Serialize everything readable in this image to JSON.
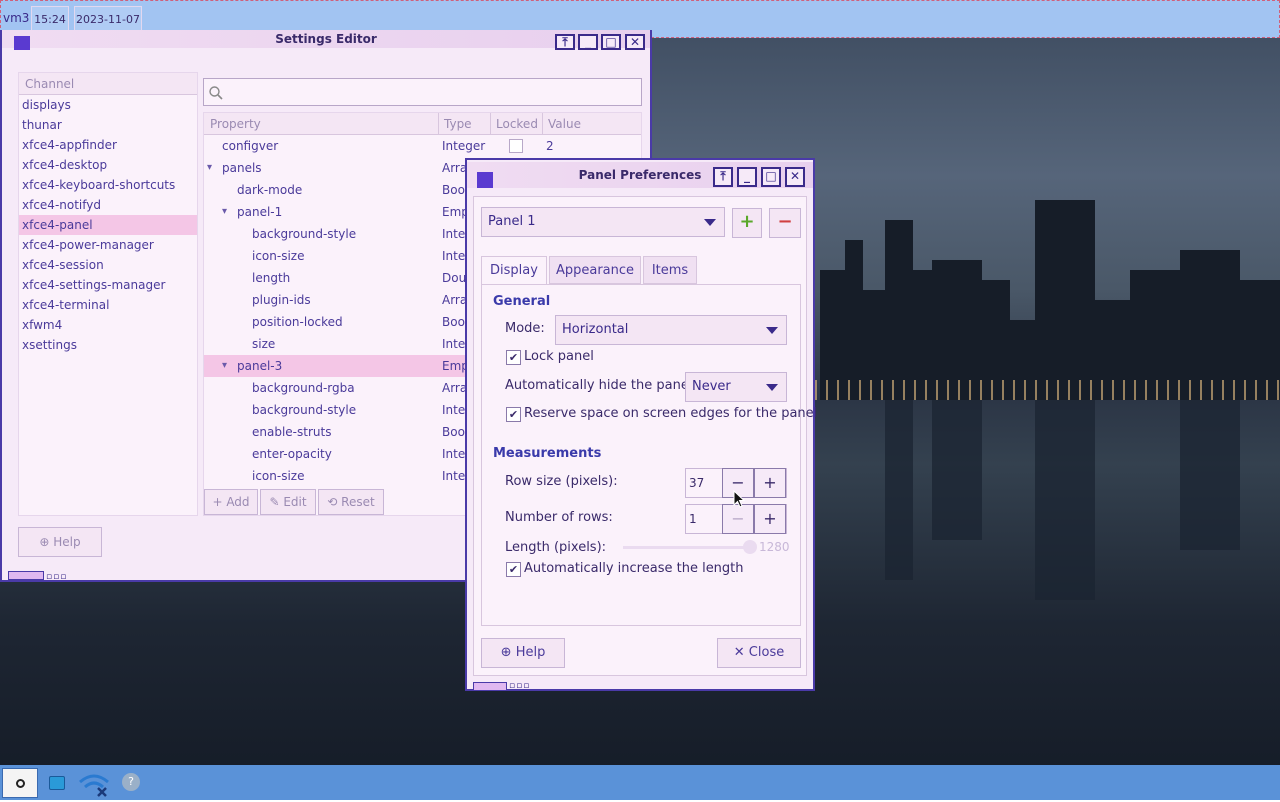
{
  "topbar": {
    "host": "vm3",
    "time": "15:24",
    "date": "2023-11-07"
  },
  "settings_editor": {
    "title": "Settings Editor",
    "search_placeholder": "",
    "channel_header": "Channel",
    "channels": [
      "displays",
      "thunar",
      "xfce4-appfinder",
      "xfce4-desktop",
      "xfce4-keyboard-shortcuts",
      "xfce4-notifyd",
      "xfce4-panel",
      "xfce4-power-manager",
      "xfce4-session",
      "xfce4-settings-manager",
      "xfce4-terminal",
      "xfwm4",
      "xsettings"
    ],
    "selected_channel": "xfce4-panel",
    "columns": {
      "property": "Property",
      "type": "Type",
      "locked": "Locked",
      "value": "Value"
    },
    "rows": [
      {
        "name": "configver",
        "type": "Integer",
        "value": "2"
      },
      {
        "name": "panels",
        "type": "Arra"
      },
      {
        "name": "dark-mode",
        "type": "Bool"
      },
      {
        "name": "panel-1",
        "type": "Emp"
      },
      {
        "name": "background-style",
        "type": "Integ"
      },
      {
        "name": "icon-size",
        "type": "Integ"
      },
      {
        "name": "length",
        "type": "Dou"
      },
      {
        "name": "plugin-ids",
        "type": "Arra"
      },
      {
        "name": "position-locked",
        "type": "Bool"
      },
      {
        "name": "size",
        "type": "Integ"
      },
      {
        "name": "panel-3",
        "type": "Emp"
      },
      {
        "name": "background-rgba",
        "type": "Arra"
      },
      {
        "name": "background-style",
        "type": "Integ"
      },
      {
        "name": "enable-struts",
        "type": "Bool"
      },
      {
        "name": "enter-opacity",
        "type": "Integ"
      },
      {
        "name": "icon-size",
        "type": "Integ"
      }
    ],
    "add_label": "Add",
    "edit_label": "Edit",
    "reset_label": "Reset",
    "help_label": "Help"
  },
  "panel_prefs": {
    "title": "Panel Preferences",
    "panel_select": "Panel 1",
    "tabs": [
      "Display",
      "Appearance",
      "Items"
    ],
    "general_heading": "General",
    "mode_label": "Mode:",
    "mode_value": "Horizontal",
    "lock_panel_label": "Lock panel",
    "lock_panel_checked": true,
    "autohide_label": "Automatically hide the panel:",
    "autohide_value": "Never",
    "reserve_label": "Reserve space on screen edges for the panel",
    "reserve_checked": true,
    "measurements_heading": "Measurements",
    "row_size_label": "Row size (pixels):",
    "row_size_value": "37",
    "num_rows_label": "Number of rows:",
    "num_rows_value": "1",
    "length_label": "Length (pixels):",
    "length_value": "1280",
    "auto_length_label": "Automatically increase the length",
    "auto_length_checked": true,
    "help_label": "Help",
    "close_label": "Close"
  },
  "colors": {
    "accent": "#4a3aa8",
    "selection": "#f4c6e6",
    "topbar": "#a2c4f2",
    "taskbar": "#5a92d8"
  }
}
